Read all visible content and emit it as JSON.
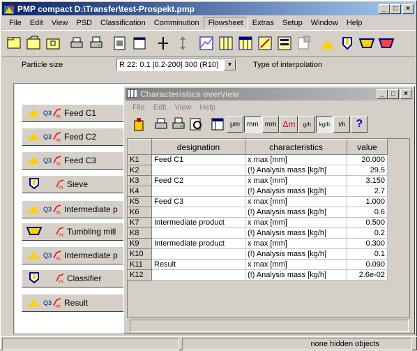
{
  "window": {
    "title": "PMP compact  D:\\Transfer\\test-Prospekt.pmp",
    "min": "_",
    "max": "□",
    "close": "×"
  },
  "menu": [
    "File",
    "Edit",
    "View",
    "PSD",
    "Classification",
    "Comminution",
    "Flowsheet",
    "Extras",
    "Setup",
    "Window",
    "Help"
  ],
  "psd_bar": {
    "label": "Particle size",
    "combo_value": "R 22: 0.1 |0.2-200| 300  (R10)",
    "interp_label": "Type of interpolation"
  },
  "nodes": [
    {
      "label": "Feed C1",
      "icon": "feed-icon"
    },
    {
      "label": "Feed C2",
      "icon": "feed-icon"
    },
    {
      "label": "Feed C3",
      "icon": "feed-icon"
    },
    {
      "label": "Sieve",
      "icon": "sieve-icon"
    },
    {
      "label": "Intermediate p",
      "icon": "feed-icon"
    },
    {
      "label": "Tumbling mill",
      "icon": "mill-icon"
    },
    {
      "label": "Intermediate p",
      "icon": "feed-icon"
    },
    {
      "label": "Classifier",
      "icon": "classifier-icon"
    },
    {
      "label": "Result",
      "icon": "feed-icon"
    }
  ],
  "child": {
    "title": "Characteristics overview",
    "menu": [
      "File",
      "Edit",
      "View",
      "Help"
    ],
    "unit_buttons": {
      "um": "µm",
      "mm": "mm",
      "mm2": "mm",
      "dm": "Δm",
      "gh": "g/h",
      "kgh": "kg/h",
      "th": "t/h",
      "help": "?"
    },
    "headers": {
      "designation": "designation",
      "characteristics": "characteristics",
      "value": "value"
    },
    "rows": [
      {
        "k": "K1",
        "designation": "Feed C1",
        "characteristic": "x max [mm]",
        "value": "20.000"
      },
      {
        "k": "K2",
        "designation": "",
        "characteristic": "(!) Analysis mass [kg/h]",
        "value": "29.5"
      },
      {
        "k": "K3",
        "designation": "Feed C2",
        "characteristic": "x max [mm]",
        "value": "3.150"
      },
      {
        "k": "K4",
        "designation": "",
        "characteristic": "(!) Analysis mass [kg/h]",
        "value": "2.7"
      },
      {
        "k": "K5",
        "designation": "Feed C3",
        "characteristic": "x max [mm]",
        "value": "1.000"
      },
      {
        "k": "K6",
        "designation": "",
        "characteristic": "(!) Analysis mass [kg/h]",
        "value": "0.6"
      },
      {
        "k": "K7",
        "designation": "Intermediate product",
        "characteristic": "x max [mm]",
        "value": "0.500"
      },
      {
        "k": "K8",
        "designation": "",
        "characteristic": "(!) Analysis mass [kg/h]",
        "value": "0.2"
      },
      {
        "k": "K9",
        "designation": "Intermediate product",
        "characteristic": "x max [mm]",
        "value": "0.300"
      },
      {
        "k": "K10",
        "designation": "",
        "characteristic": "(!) Analysis mass [kg/h]",
        "value": "0.1"
      },
      {
        "k": "K11",
        "designation": "Result",
        "characteristic": "x max [mm]",
        "value": "0.090"
      },
      {
        "k": "K12",
        "designation": "",
        "characteristic": "(!) Analysis mass [kg/h]",
        "value": "2.6e-02"
      }
    ]
  },
  "status": {
    "hidden": "none hidden objects"
  },
  "colors": {
    "title_active": "#0a246a",
    "title_inactive": "#808080",
    "face": "#d4d0c8"
  }
}
